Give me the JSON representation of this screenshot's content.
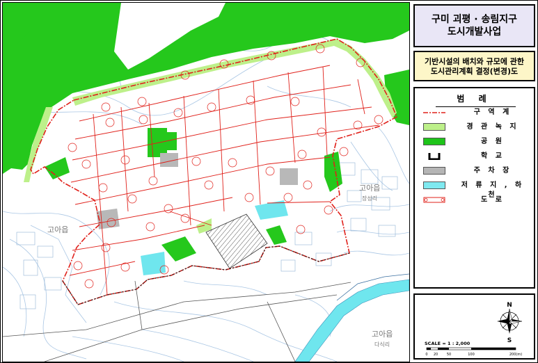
{
  "title": {
    "line1": "구미 괴평 · 송림지구",
    "line2": "도시개발사업"
  },
  "subtitle": {
    "line1": "기반시설의 배치와 규모에 관한",
    "line2": "도시관리계획 결정(변경)도"
  },
  "legend": {
    "title": "범 례",
    "items": [
      {
        "key": "district",
        "label": "구 역 계",
        "color": "#e0201a"
      },
      {
        "key": "landscape",
        "label": "경 관 녹 지",
        "color": "#b9ec7a"
      },
      {
        "key": "park",
        "label": "공 원",
        "color": "#1ec41a"
      },
      {
        "key": "school",
        "label": "학 교",
        "color": "#000000"
      },
      {
        "key": "parking",
        "label": "주 차 장",
        "color": "#b5b5b5"
      },
      {
        "key": "reservoir",
        "label": "저 류 지 , 하 천",
        "color": "#7fe9f0"
      },
      {
        "key": "road",
        "label": "도 로",
        "color": "#e0201a"
      }
    ]
  },
  "scale": {
    "text": "SCALE = 1 : 2,000",
    "ticks": [
      "0",
      "20",
      "50",
      "100",
      "200(m)"
    ]
  },
  "north": {
    "n": "N",
    "s": "S"
  },
  "map_labels": {
    "goaeup1": "고아읍",
    "goaeup2": "고아읍",
    "goaeup3": "고아읍",
    "dasik": "다식리",
    "jangsang": "장성리"
  },
  "colors": {
    "greenbelt": "#25c81c",
    "landscape": "#bdf08a",
    "boundary": "#e0201a",
    "stream": "#6fe6ee",
    "parking": "#b8b8b8",
    "contour": "#9fc0e0"
  }
}
